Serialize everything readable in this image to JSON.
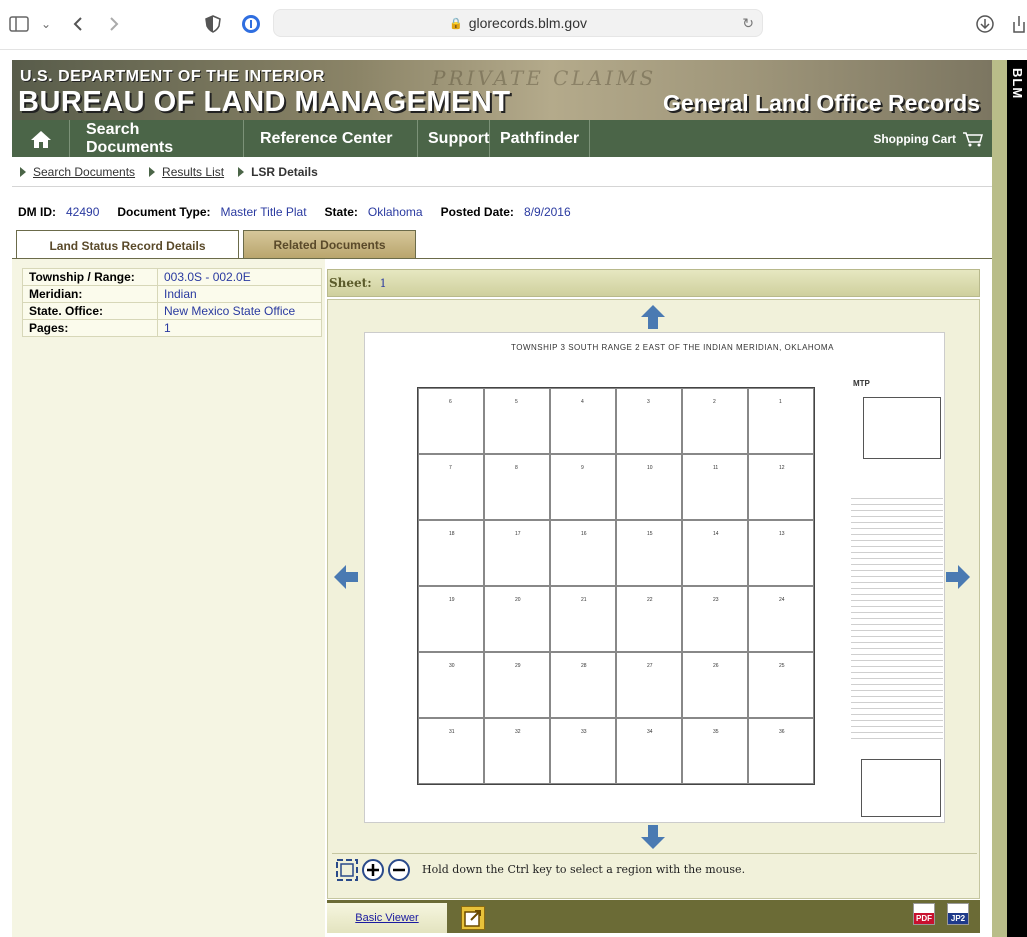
{
  "browser": {
    "url": "glorecords.blm.gov"
  },
  "banner": {
    "department": "U.S. DEPARTMENT OF THE INTERIOR",
    "bureau": "BUREAU OF LAND MANAGEMENT",
    "site_title": "General Land Office Records",
    "watermark": "PRIVATE CLAIMS",
    "side_tab": "BLM"
  },
  "nav": {
    "items": [
      {
        "label": "Search Documents"
      },
      {
        "label": "Reference Center"
      },
      {
        "label": "Support"
      },
      {
        "label": "Pathfinder"
      }
    ],
    "cart": "Shopping Cart"
  },
  "breadcrumb": [
    {
      "label": "Search Documents"
    },
    {
      "label": "Results List"
    },
    {
      "label": "LSR Details"
    }
  ],
  "doc": {
    "dm_id_label": "DM ID:",
    "dm_id": "42490",
    "doc_type_label": "Document Type:",
    "doc_type": "Master Title Plat",
    "state_label": "State:",
    "state": "Oklahoma",
    "posted_label": "Posted Date:",
    "posted": "8/9/2016"
  },
  "tabs": [
    {
      "label": "Land Status Record Details",
      "active": true
    },
    {
      "label": "Related Documents",
      "active": false
    }
  ],
  "details": [
    {
      "key": "Township / Range:",
      "value": "003.0S - 002.0E"
    },
    {
      "key": "Meridian:",
      "value": "Indian"
    },
    {
      "key": "State. Office:",
      "value": "New Mexico State Office"
    },
    {
      "key": "Pages:",
      "value": "1"
    }
  ],
  "viewer": {
    "sheet_label": "Sheet:",
    "sheet_num": "1",
    "hint": "Hold down the Ctrl key to select a region with the mouse.",
    "basic_viewer": "Basic Viewer",
    "pdf_label": "PDF",
    "jp2_label": "JP2"
  },
  "plat": {
    "title": "TOWNSHIP  3  SOUTH  RANGE  2  EAST  OF THE       INDIAN       MERIDIAN, OKLAHOMA",
    "mtp": "MTP",
    "sections": [
      "6",
      "5",
      "4",
      "3",
      "2",
      "1",
      "7",
      "8",
      "9",
      "10",
      "11",
      "12",
      "18",
      "17",
      "16",
      "15",
      "14",
      "13",
      "19",
      "20",
      "21",
      "22",
      "23",
      "24",
      "30",
      "29",
      "28",
      "27",
      "26",
      "25",
      "31",
      "32",
      "33",
      "34",
      "35",
      "36"
    ]
  },
  "colors": {
    "nav_green": "#4b6548",
    "tab_tan": "#b9a56d",
    "link_blue": "#2a3aa0",
    "arrow_blue": "#4a7ab2"
  }
}
